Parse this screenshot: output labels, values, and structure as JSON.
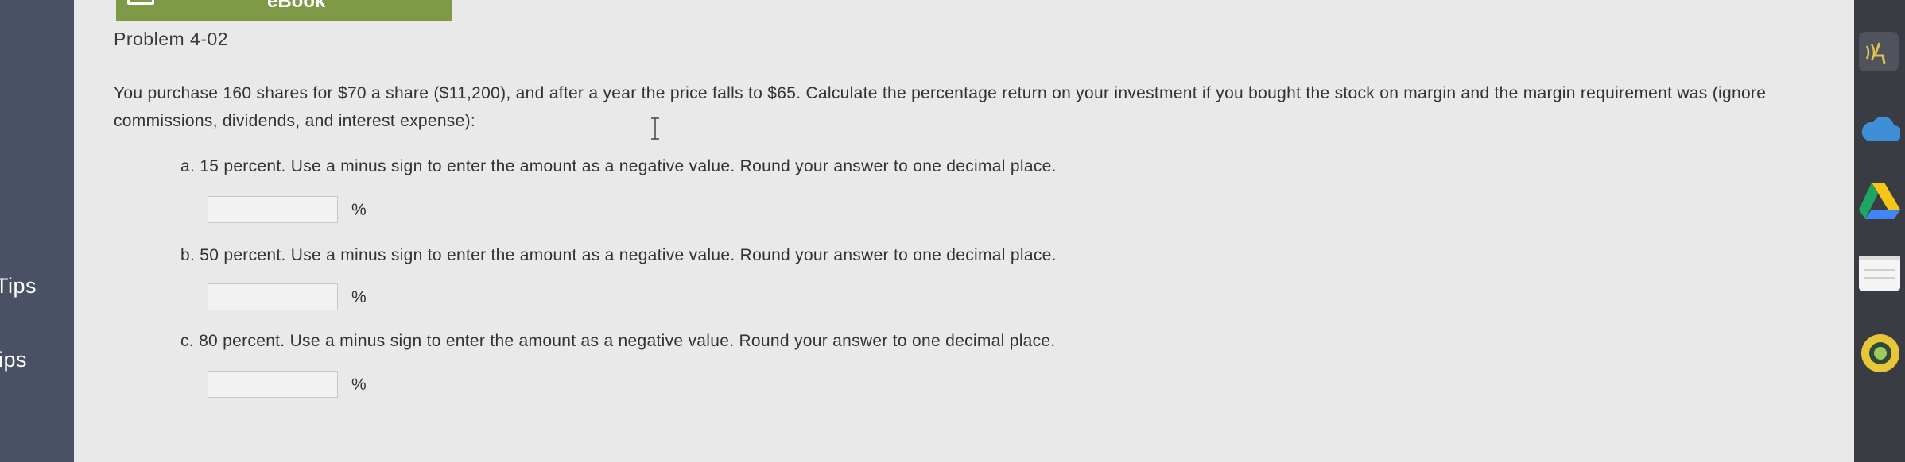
{
  "ebook_tab": {
    "label": "eBook"
  },
  "sidebar": {
    "tips": [
      "Tips",
      "ips"
    ]
  },
  "problem": {
    "title": "Problem 4-02",
    "text": "You purchase 160 shares for $70 a share ($11,200), and after a year the price falls to $65. Calculate the percentage return on your investment if you bought the stock on margin and the margin requirement was (ignore commissions, dividends, and interest expense):",
    "questions": [
      {
        "label": "a. 15 percent. Use a minus sign to enter the amount as a negative value. Round your answer to one decimal place.",
        "value": "",
        "unit": "%"
      },
      {
        "label": "b. 50 percent. Use a minus sign to enter the amount as a negative value. Round your answer to one decimal place.",
        "value": "",
        "unit": "%"
      },
      {
        "label": "c. 80 percent. Use a minus sign to enter the amount as a negative value. Round your answer to one decimal place.",
        "value": "",
        "unit": "%"
      }
    ]
  },
  "colors": {
    "ebook_green": "#7f9a47",
    "sidebar": "#4b5164",
    "page_bg": "#e9e9e9"
  }
}
